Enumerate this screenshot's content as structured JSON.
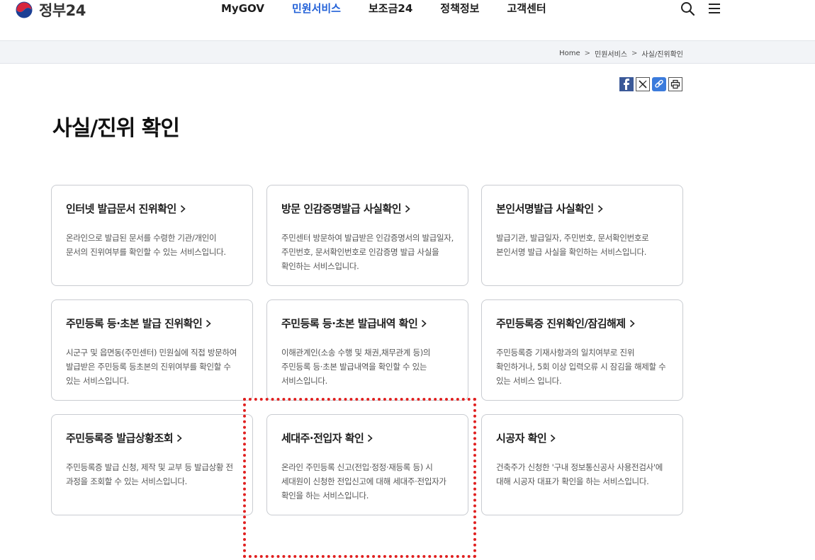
{
  "header": {
    "logo_text": "정부24",
    "nav": [
      "MyGOV",
      "민원서비스",
      "보조금24",
      "정책정보",
      "고객센터"
    ],
    "active_nav": "민원서비스",
    "accent_color": "#2563d8"
  },
  "breadcrumb": [
    "Home",
    "민원서비스",
    "사실/진위확인"
  ],
  "share_icons": [
    "facebook-icon",
    "x-icon",
    "link-icon",
    "print-icon"
  ],
  "page_title": "사실/진위 확인",
  "cards": [
    {
      "title": "인터넷 발급문서 진위확인",
      "desc": "온라인으로 발급된 문서를 수령한 기관/개인이 문서의 진위여부를 확인할 수 있는 서비스입니다."
    },
    {
      "title": "방문 인감증명발급 사실확인",
      "desc": "주민센터 방문하여 발급받은 인감증명서의 발급일자, 주민번호, 문서확인번호로 인감증명 발급 사실을 확인하는 서비스입니다."
    },
    {
      "title": "본인서명발급 사실확인",
      "desc": "발급기관, 발급일자, 주민번호, 문서확인번호로 본인서명 발급 사실을 확인하는 서비스입니다."
    },
    {
      "title": "주민등록 등·초본 발급 진위확인",
      "desc": "시군구 및 읍면동(주민센터) 민원실에 직접 방문하여 발급받은 주민등록 등초본의 진위여부를 확인할 수 있는 서비스입니다."
    },
    {
      "title": "주민등록 등·초본 발급내역 확인",
      "desc": "이해관계인(소송 수행 및 채권,채무관계 등)의 주민등록 등·초본 발급내역을 확인할 수 있는 서비스입니다."
    },
    {
      "title": "주민등록증 진위확인/잠김해제",
      "desc": "주민등록증 기재사항과의 일치여부로 진위 확인하거나, 5회 이상 입력오류 시 잠김을 해제할 수 있는 서비스 입니다."
    },
    {
      "title": "주민등록증 발급상황조회",
      "desc": "주민등록증 발급 신청, 제작 및 교부 등 발급상황 전 과정을 조회할 수 있는 서비스입니다."
    },
    {
      "title": "세대주·전입자 확인",
      "desc": "온라인 주민등록 신고(전입·정정·재등록 등) 시 세대원이 신청한 전입신고에 대해 세대주·전입자가 확인을 하는 서비스입니다."
    },
    {
      "title": "시공자 확인",
      "desc": "건축주가 신청한 '구내 정보통신공사 사용전검사'에 대해 시공자 대표가 확인을 하는 서비스입니다."
    }
  ],
  "highlight_color": "#e02020"
}
